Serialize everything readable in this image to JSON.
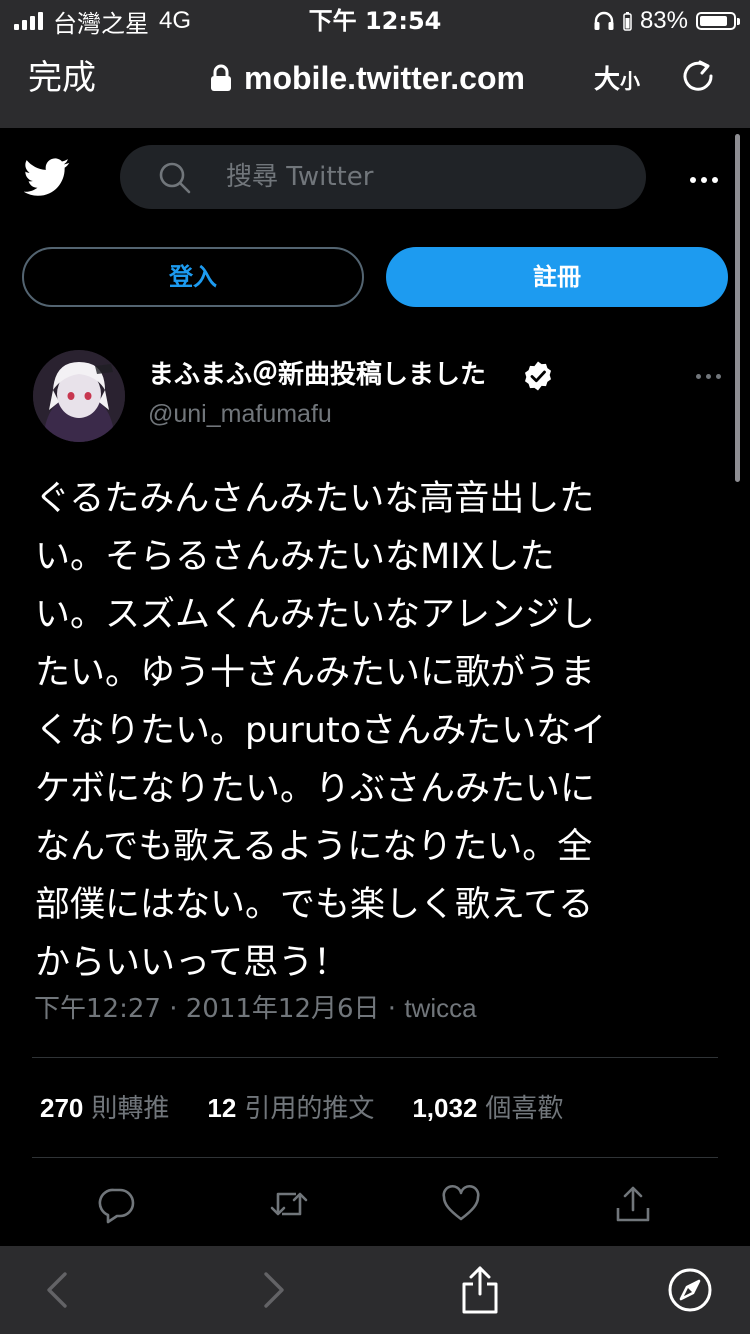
{
  "status_bar": {
    "carrier": "台灣之星",
    "network": "4G",
    "time": "下午 12:54",
    "battery": "83%",
    "battery_level": 0.83
  },
  "browser": {
    "done_label": "完成",
    "url": "mobile.twitter.com",
    "text_size_big": "大",
    "text_size_small": "小"
  },
  "header": {
    "search_placeholder": "搜尋 Twitter",
    "login_label": "登入",
    "signup_label": "註冊"
  },
  "tweet": {
    "display_name": "まふまふ＠新曲投稿しました",
    "handle": "@uni_mafumafu",
    "text": "ぐるたみんさんみたいな高音出した\nい。そらるさんみたいなMIXした\nい。スズムくんみたいなアレンジし\nたい。ゆう十さんみたいに歌がうま\nくなりたい。purutoさんみたいなイ\nケボになりたい。りぶさんみたいに\nなんでも歌えるようになりたい。全\n部僕にはない。でも楽しく歌えてる\nからいいって思う！",
    "time": "下午12:27",
    "date": "2011年12月6日",
    "source": "twicca",
    "meta_separator": "·",
    "stats": [
      {
        "count": "270",
        "label": "則轉推"
      },
      {
        "count": "12",
        "label": "引用的推文"
      },
      {
        "count": "1,032",
        "label": "個喜歡"
      }
    ],
    "actions": [
      "reply-icon",
      "retweet-icon",
      "like-icon",
      "share-icon"
    ]
  },
  "colors": {
    "accent": "#1d9bf0",
    "background": "#000000",
    "chrome": "#2c2c2e",
    "muted_text": "#71767b",
    "divider": "#2f3336"
  },
  "toolbar_icons": [
    "back-icon",
    "forward-icon",
    "share-icon",
    "compass-icon"
  ]
}
